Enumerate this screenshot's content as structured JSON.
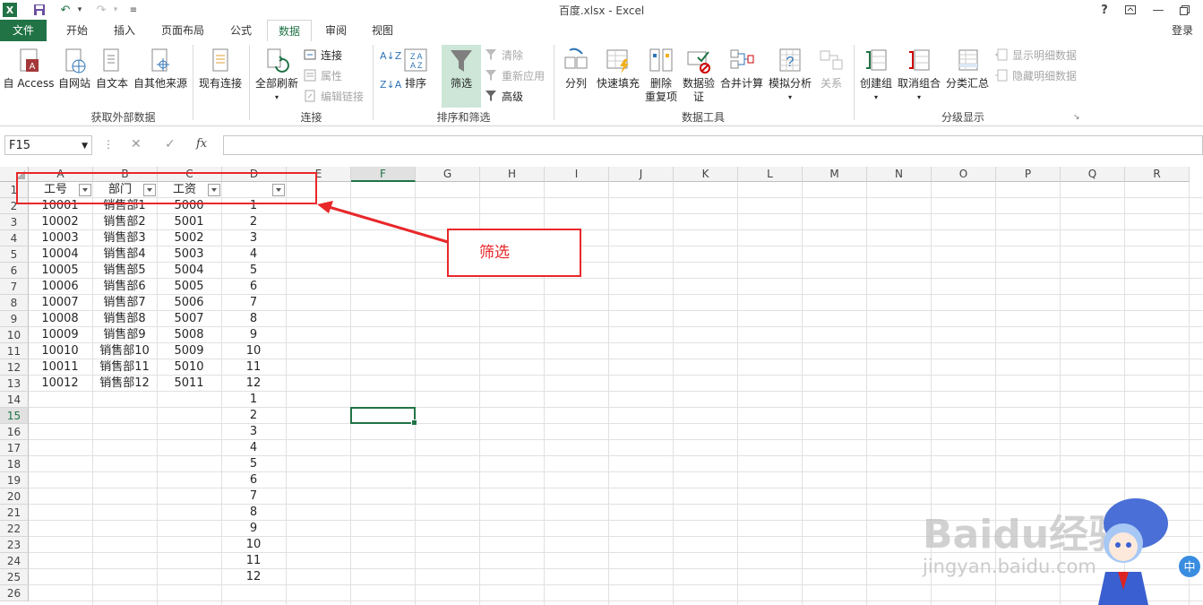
{
  "window": {
    "title": "百度.xlsx - Excel",
    "help": "?",
    "login": "登录"
  },
  "tabs": [
    "文件",
    "开始",
    "插入",
    "页面布局",
    "公式",
    "数据",
    "审阅",
    "视图"
  ],
  "ribbon": {
    "get_external": {
      "access": "自 Access",
      "web": "自网站",
      "text": "自文本",
      "other": "自其他来源",
      "existing": "现有连接",
      "group": "获取外部数据"
    },
    "connections": {
      "refresh_all": "全部刷新",
      "connect": "连接",
      "props": "属性",
      "edit_links": "编辑链接",
      "group": "连接"
    },
    "sort_filter": {
      "sort": "排序",
      "filter": "筛选",
      "clear": "清除",
      "reapply": "重新应用",
      "advanced": "高级",
      "group": "排序和筛选"
    },
    "data_tools": {
      "split": "分列",
      "flash_fill": "快速填充",
      "remove_dup_1": "删除",
      "remove_dup_2": "重复项",
      "validate_1": "数据验",
      "validate_2": "证",
      "consolidate": "合并计算",
      "what_if": "模拟分析",
      "relations": "关系",
      "group": "数据工具"
    },
    "outline": {
      "group_btn": "创建组",
      "ungroup": "取消组合",
      "subtotal": "分类汇总",
      "show_detail": "显示明细数据",
      "hide_detail": "隐藏明细数据",
      "group": "分级显示"
    }
  },
  "formula_bar": {
    "name_box": "F15",
    "fx": "fx",
    "value": ""
  },
  "columns": [
    "A",
    "B",
    "C",
    "D",
    "E",
    "F",
    "G",
    "H",
    "I",
    "J",
    "K",
    "L",
    "M",
    "N",
    "O",
    "P",
    "Q",
    "R"
  ],
  "selected_column": "F",
  "selected_row": 15,
  "rows": [
    "1",
    "2",
    "3",
    "4",
    "5",
    "6",
    "7",
    "8",
    "9",
    "10",
    "11",
    "12",
    "13",
    "14",
    "15",
    "16",
    "17",
    "18",
    "19",
    "20",
    "21",
    "22",
    "23",
    "24",
    "25",
    "26"
  ],
  "headers": [
    "工号",
    "部门",
    "工资",
    ""
  ],
  "table": [
    [
      "10001",
      "销售部1",
      "5000",
      "1"
    ],
    [
      "10002",
      "销售部2",
      "5001",
      "2"
    ],
    [
      "10003",
      "销售部3",
      "5002",
      "3"
    ],
    [
      "10004",
      "销售部4",
      "5003",
      "4"
    ],
    [
      "10005",
      "销售部5",
      "5004",
      "5"
    ],
    [
      "10006",
      "销售部6",
      "5005",
      "6"
    ],
    [
      "10007",
      "销售部7",
      "5006",
      "7"
    ],
    [
      "10008",
      "销售部8",
      "5007",
      "8"
    ],
    [
      "10009",
      "销售部9",
      "5008",
      "9"
    ],
    [
      "10010",
      "销售部10",
      "5009",
      "10"
    ],
    [
      "10011",
      "销售部11",
      "5010",
      "11"
    ],
    [
      "10012",
      "销售部12",
      "5011",
      "12"
    ]
  ],
  "d_extra": [
    "1",
    "2",
    "3",
    "4",
    "5",
    "6",
    "7",
    "8",
    "9",
    "10",
    "11",
    "12"
  ],
  "annotation": "筛选",
  "watermark": {
    "line1": "Baidu经验",
    "line2": "jingyan.baidu.com"
  },
  "colors": {
    "accent": "#217346",
    "annotation": "#e8272a"
  }
}
